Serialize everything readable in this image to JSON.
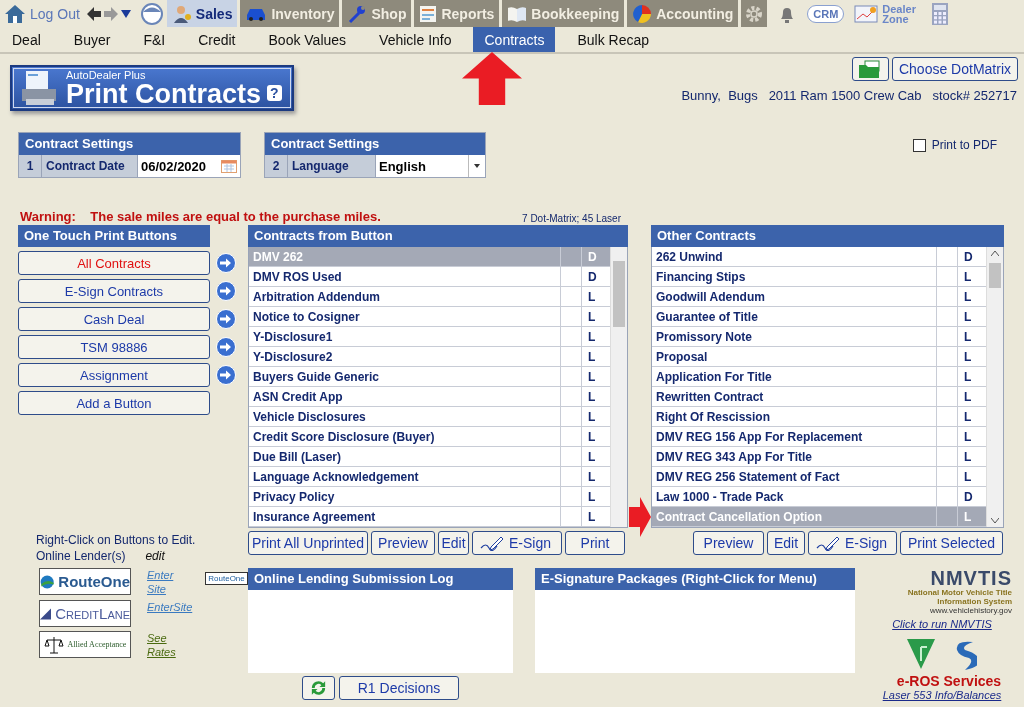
{
  "top_bar": {
    "logout": "Log Out",
    "modules": [
      {
        "label": "Sales",
        "kind": "person",
        "selected": true
      },
      {
        "label": "Inventory",
        "kind": "car",
        "selected": false
      },
      {
        "label": "Shop",
        "kind": "wrench",
        "selected": false
      },
      {
        "label": "Reports",
        "kind": "report",
        "selected": false
      },
      {
        "label": "Bookkeeping",
        "kind": "book",
        "selected": false
      },
      {
        "label": "Accounting",
        "kind": "pie",
        "selected": false
      }
    ],
    "crm": "CRM",
    "dealer_zone": "Dealer Zone"
  },
  "subtabs": [
    {
      "label": "Deal",
      "selected": false
    },
    {
      "label": "Buyer",
      "selected": false
    },
    {
      "label": "F&I",
      "selected": false
    },
    {
      "label": "Credit",
      "selected": false
    },
    {
      "label": "Book Values",
      "selected": false
    },
    {
      "label": "Vehicle Info",
      "selected": false
    },
    {
      "label": "Contracts",
      "selected": true
    },
    {
      "label": "Bulk Recap",
      "selected": false
    }
  ],
  "annotations": [
    {
      "kind": "up"
    },
    {
      "kind": "right"
    }
  ],
  "banner": {
    "brand": "AutoDealer Plus",
    "title": "Print Contracts",
    "help": "?"
  },
  "printer_button": "Choose DotMatrix",
  "deal_info": {
    "customer": "Bunny,  Bugs",
    "vehicle": "2011 Ram 1500 Crew Cab",
    "stock": "stock# 252717"
  },
  "settings": [
    {
      "title": "Contract Settings",
      "number": "1",
      "label": "Contract Date",
      "value": "06/02/2020",
      "kind": "date"
    },
    {
      "title": "Contract Settings",
      "number": "2",
      "label": "Language",
      "value": "English",
      "kind": "select"
    }
  ],
  "print_to_pdf": {
    "label": "Print to PDF",
    "checked": false
  },
  "warning": {
    "label": "Warning:",
    "message": "The sale miles are equal to the purchase miles."
  },
  "printer_counts": "7 Dot-Matrix; 45 Laser",
  "one_touch": {
    "title": "One Touch Print Buttons",
    "buttons": [
      {
        "label": "All Contracts",
        "selected": true,
        "kind": "preset"
      },
      {
        "label": "E-Sign Contracts",
        "selected": false,
        "kind": "preset"
      },
      {
        "label": "Cash Deal",
        "selected": false,
        "kind": "preset"
      },
      {
        "label": "TSM 98886",
        "selected": false,
        "kind": "preset"
      },
      {
        "label": "Assignment",
        "selected": false,
        "kind": "preset"
      },
      {
        "label": "Add a Button",
        "selected": false,
        "kind": "add"
      }
    ]
  },
  "contracts_from_button": {
    "title": "Contracts from Button",
    "rows": [
      {
        "name": "DMV 262",
        "type": "D",
        "selected": true
      },
      {
        "name": "DMV ROS Used",
        "type": "D",
        "selected": false
      },
      {
        "name": "Arbitration Addendum",
        "type": "L",
        "selected": false
      },
      {
        "name": "Notice to Cosigner",
        "type": "L",
        "selected": false
      },
      {
        "name": "Y-Disclosure1",
        "type": "L",
        "selected": false
      },
      {
        "name": "Y-Disclosure2",
        "type": "L",
        "selected": false
      },
      {
        "name": "Buyers Guide Generic",
        "type": "L",
        "selected": false
      },
      {
        "name": "ASN Credit App",
        "type": "L",
        "selected": false
      },
      {
        "name": "Vehicle Disclosures",
        "type": "L",
        "selected": false
      },
      {
        "name": "Credit Score Disclosure (Buyer)",
        "type": "L",
        "selected": false
      },
      {
        "name": "Due Bill (Laser)",
        "type": "L",
        "selected": false
      },
      {
        "name": "Language Acknowledgement",
        "type": "L",
        "selected": false
      },
      {
        "name": "Privacy Policy",
        "type": "L",
        "selected": false
      },
      {
        "name": "Insurance Agreement",
        "type": "L",
        "selected": false
      }
    ],
    "actions": [
      {
        "label": "Print All Unprinted",
        "kind": "text"
      },
      {
        "label": "Preview",
        "kind": "text"
      },
      {
        "label": "Edit",
        "kind": "text"
      },
      {
        "label": "E-Sign",
        "kind": "esign"
      },
      {
        "label": "Print",
        "kind": "text"
      }
    ]
  },
  "other_contracts": {
    "title": "Other Contracts",
    "rows": [
      {
        "name": "262 Unwind",
        "type": "D",
        "selected": false
      },
      {
        "name": "Financing Stips",
        "type": "L",
        "selected": false
      },
      {
        "name": "Goodwill Adendum",
        "type": "L",
        "selected": false
      },
      {
        "name": "Guarantee of Title",
        "type": "L",
        "selected": false
      },
      {
        "name": "Promissory Note",
        "type": "L",
        "selected": false
      },
      {
        "name": "Proposal",
        "type": "L",
        "selected": false
      },
      {
        "name": "Application For Title",
        "type": "L",
        "selected": false
      },
      {
        "name": "Rewritten Contract",
        "type": "L",
        "selected": false
      },
      {
        "name": "Right Of Rescission",
        "type": "L",
        "selected": false
      },
      {
        "name": "DMV REG 156 App For Replacement",
        "type": "L",
        "selected": false
      },
      {
        "name": "DMV REG 343 App For Title",
        "type": "L",
        "selected": false
      },
      {
        "name": "DMV REG 256 Statement of Fact",
        "type": "L",
        "selected": false
      },
      {
        "name": "Law 1000 - Trade Pack",
        "type": "D",
        "selected": false
      },
      {
        "name": "Contract Cancellation Option",
        "type": "L",
        "selected": true
      }
    ],
    "actions": [
      {
        "label": "Preview",
        "kind": "text"
      },
      {
        "label": "Edit",
        "kind": "text"
      },
      {
        "label": "E-Sign",
        "kind": "esign"
      },
      {
        "label": "Print Selected",
        "kind": "text"
      }
    ]
  },
  "lenders": {
    "hint": "Right-Click on Buttons to Edit.",
    "title": "Online Lender(s)",
    "edit": "edit",
    "items": [
      {
        "kind": "routeone",
        "logo": "RouteOne",
        "link": "Enter Site",
        "badge": "RouteOne"
      },
      {
        "kind": "creditlane",
        "logo": "CreditLane",
        "link": "EnterSite"
      },
      {
        "kind": "allied",
        "logo": "Allied Acceptance",
        "link": "See Rates"
      }
    ]
  },
  "lending_log": {
    "title": "Online Lending Submission Log",
    "button": "R1 Decisions"
  },
  "esign_packages": {
    "title": "E-Signature Packages (Right-Click for Menu)"
  },
  "nmvtis": {
    "logo": "NMVTIS",
    "subtitle": "National Motor Vehicle Title Information System",
    "url": "www.vehiclehistory.gov",
    "link": "Click to run NMVTIS"
  },
  "eros": {
    "title": "e-ROS Services",
    "link": "Laser 553 Info/Balances"
  }
}
